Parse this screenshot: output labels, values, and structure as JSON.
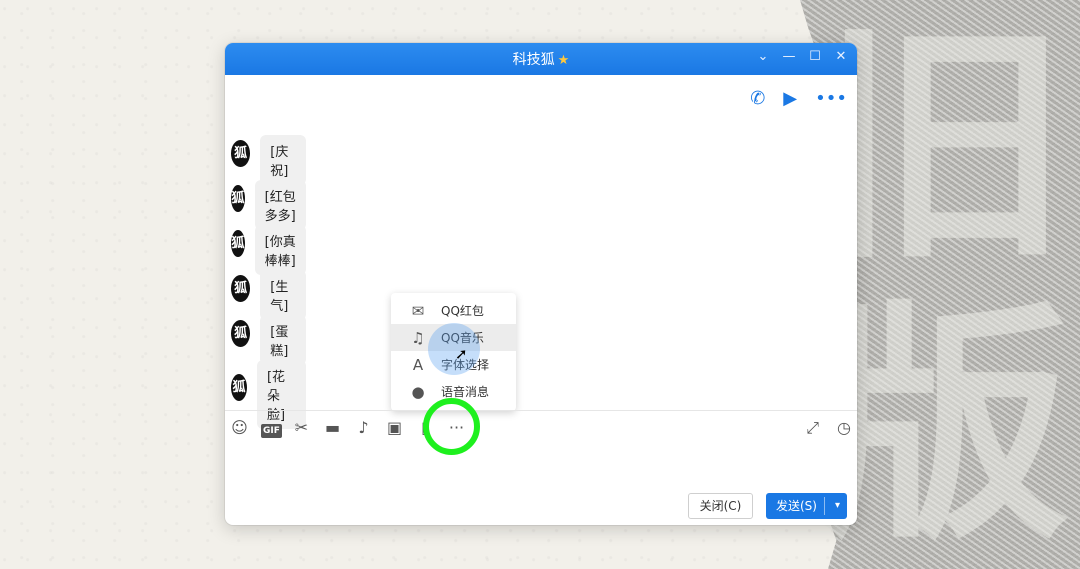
{
  "background": {
    "big_chars": [
      "旧",
      "版"
    ]
  },
  "window": {
    "title": "科技狐",
    "title_badge_icon": "star-icon",
    "controls": [
      "chevron-down-icon",
      "minimize-icon",
      "maximize-icon",
      "close-icon"
    ],
    "header_actions": [
      "phone-icon",
      "video-icon",
      "more-icon"
    ]
  },
  "messages": [
    {
      "avatar": "狐",
      "text": "[庆祝]"
    },
    {
      "avatar": "狐",
      "text": "[红包多多]"
    },
    {
      "avatar": "狐",
      "text": "[你真棒棒]"
    },
    {
      "avatar": "狐",
      "text": "[生气]"
    },
    {
      "avatar": "狐",
      "text": "[蛋糕]"
    },
    {
      "avatar": "狐",
      "text": "[花朵脸]"
    }
  ],
  "popup_menu": {
    "items": [
      {
        "icon": "red-envelope-icon",
        "label": "QQ红包"
      },
      {
        "icon": "music-icon",
        "label": "QQ音乐",
        "active": true
      },
      {
        "icon": "font-icon",
        "label": "字体选择"
      },
      {
        "icon": "microphone-icon",
        "label": "语音消息"
      }
    ]
  },
  "input_toolbar": {
    "items": [
      "emoji-icon",
      "gif-icon",
      "scissors-icon",
      "folder-icon",
      "music-note-icon",
      "image-icon",
      "phone-transfer-icon",
      "more-icon"
    ],
    "gif_label": "GIF",
    "right_items": [
      "expand-icon",
      "history-icon"
    ]
  },
  "buttons": {
    "close_label": "关闭(C)",
    "send_label": "发送(S)"
  },
  "colors": {
    "title_bar": "#1a78e4",
    "highlight_ring": "#1ef01e",
    "send_button": "#1a78e4"
  }
}
